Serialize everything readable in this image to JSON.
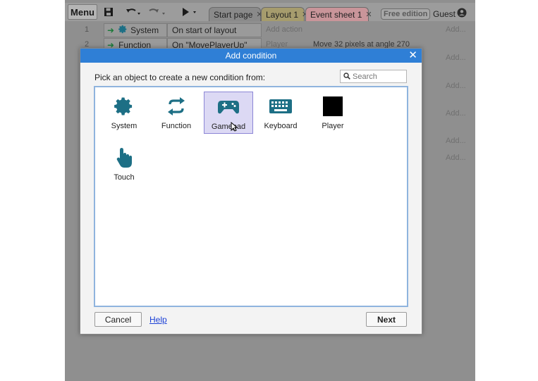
{
  "toolbar": {
    "menu_label": "Menu",
    "tabs": [
      {
        "label": "Start page"
      },
      {
        "label": "Layout 1"
      },
      {
        "label": "Event sheet 1"
      }
    ],
    "edition_badge": "Free edition",
    "user_label": "Guest"
  },
  "event_sheet": {
    "rows": [
      {
        "number": "1",
        "object": "System",
        "condition": "On start of layout",
        "action": "Add action"
      },
      {
        "number": "2",
        "object": "Function",
        "condition": "On \"MovePlayerUp\"",
        "action_object": "Player",
        "action": "Move 32 pixels at angle 270"
      }
    ],
    "add_label": "Add..."
  },
  "dialog": {
    "title": "Add condition",
    "prompt": "Pick an object to create a new condition from:",
    "search_placeholder": "Search",
    "objects": [
      {
        "label": "System",
        "icon": "gear-icon",
        "selected": false
      },
      {
        "label": "Function",
        "icon": "refresh-arrows-icon",
        "selected": false
      },
      {
        "label": "Gamepad",
        "icon": "gamepad-icon",
        "selected": true
      },
      {
        "label": "Keyboard",
        "icon": "keyboard-icon",
        "selected": false
      },
      {
        "label": "Player",
        "icon": "black-square-sprite-icon",
        "selected": false
      },
      {
        "label": "Touch",
        "icon": "touch-finger-icon",
        "selected": false
      }
    ],
    "cancel_label": "Cancel",
    "help_label": "Help",
    "next_label": "Next"
  },
  "colors": {
    "title_bar": "#2f7fd6",
    "icon_teal": "#1d6f85",
    "selection_bg": "#dcd9f4",
    "panel_border": "#8fb4de"
  }
}
